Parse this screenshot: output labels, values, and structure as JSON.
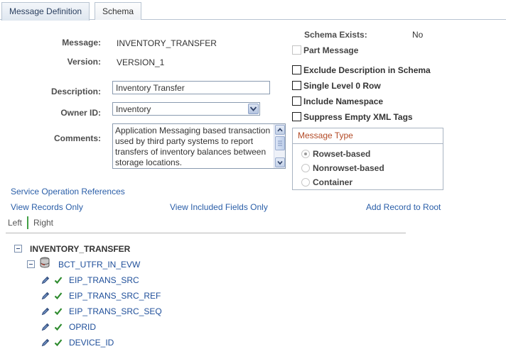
{
  "tabs": [
    {
      "label": "Message Definition",
      "active": true
    },
    {
      "label": "Schema",
      "active": false
    }
  ],
  "form": {
    "message_label": "Message:",
    "message_value": "INVENTORY_TRANSFER",
    "version_label": "Version:",
    "version_value": "VERSION_1",
    "description_label": "Description:",
    "description_value": "Inventory Transfer",
    "owner_label": "Owner ID:",
    "owner_value": "Inventory",
    "comments_label": "Comments:",
    "comments_value": "Application Messaging based transaction used by third party systems to report transfers of inventory balances between storage locations."
  },
  "options": {
    "schema_exists_label": "Schema Exists:",
    "schema_exists_value": "No",
    "part_message": "Part Message",
    "exclude_description": "Exclude Description in Schema",
    "single_level": "Single Level 0 Row",
    "include_namespace": "Include Namespace",
    "suppress_empty": "Suppress Empty XML Tags"
  },
  "message_type": {
    "header": "Message Type",
    "options": [
      "Rowset-based",
      "Nonrowset-based",
      "Container"
    ],
    "selected": "Rowset-based"
  },
  "links": {
    "service_operation_references": "Service Operation References",
    "view_records_only": "View Records Only",
    "view_included_fields_only": "View Included Fields Only",
    "add_record_to_root": "Add Record to Root"
  },
  "nav": {
    "left": "Left",
    "right": "Right"
  },
  "tree": {
    "root": "INVENTORY_TRANSFER",
    "record": "BCT_UTFR_IN_EVW",
    "fields": [
      "EIP_TRANS_SRC",
      "EIP_TRANS_SRC_REF",
      "EIP_TRANS_SRC_SEQ",
      "OPRID",
      "DEVICE_ID"
    ]
  },
  "colors": {
    "link": "#2a5ea8",
    "group_header": "#b34a26",
    "check_green": "#2e8b2e",
    "separator_green": "#43a047"
  }
}
